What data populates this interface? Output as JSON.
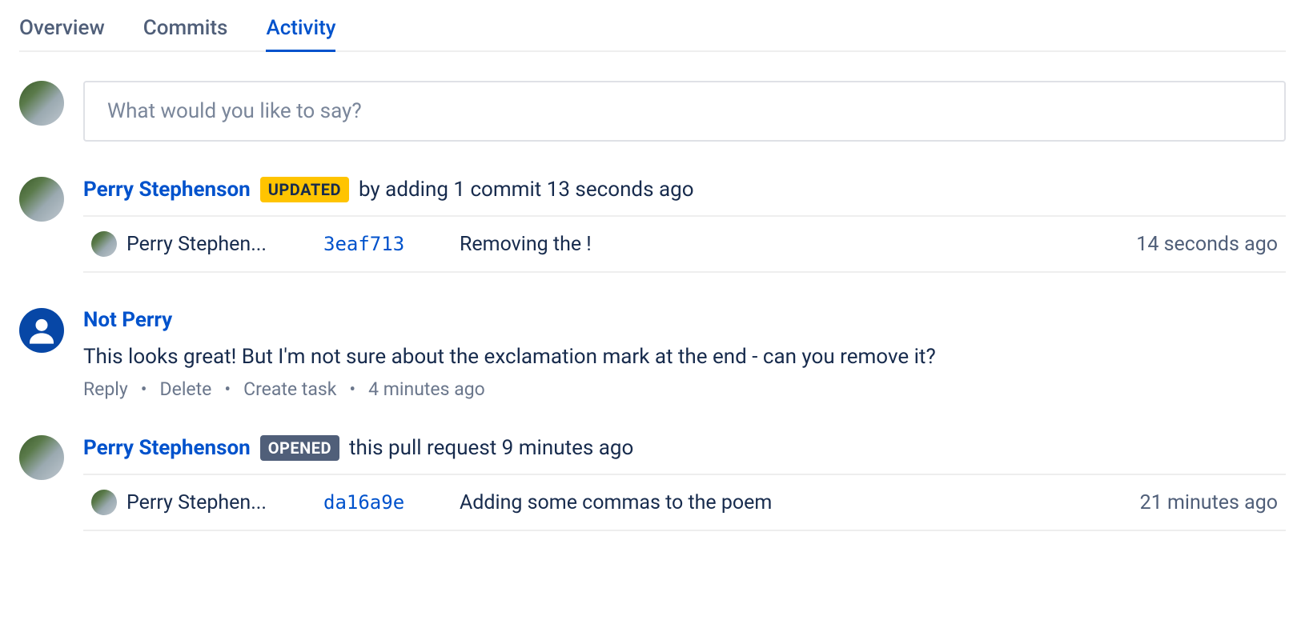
{
  "tabs": [
    {
      "label": "Overview",
      "active": false
    },
    {
      "label": "Commits",
      "active": false
    },
    {
      "label": "Activity",
      "active": true
    }
  ],
  "comment_input": {
    "placeholder": "What would you like to say?"
  },
  "activity": [
    {
      "type": "update",
      "author": "Perry Stephenson",
      "badge": "UPDATED",
      "text": "by adding 1 commit 13 seconds ago",
      "commits": [
        {
          "author": "Perry Stephen...",
          "hash": "3eaf713",
          "message": "Removing the !",
          "time": "14 seconds ago"
        }
      ]
    },
    {
      "type": "comment",
      "author": "Not Perry",
      "body": "This looks great! But I'm not sure about the exclamation mark at the end - can you remove it?",
      "actions": {
        "reply": "Reply",
        "delete": "Delete",
        "create_task": "Create task",
        "time": "4 minutes ago"
      }
    },
    {
      "type": "opened",
      "author": "Perry Stephenson",
      "badge": "OPENED",
      "text": "this pull request 9 minutes ago",
      "commits": [
        {
          "author": "Perry Stephen...",
          "hash": "da16a9e",
          "message": "Adding some commas to the poem",
          "time": "21 minutes ago"
        }
      ]
    }
  ]
}
